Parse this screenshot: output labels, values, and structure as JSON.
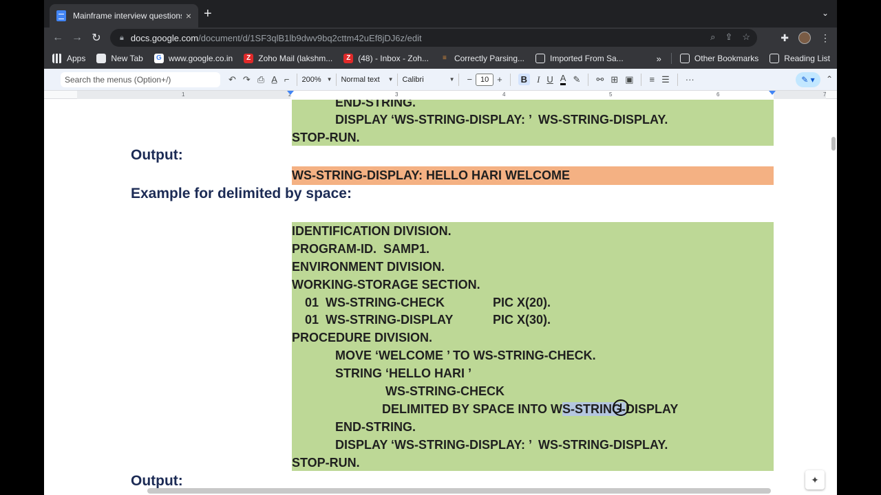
{
  "browser": {
    "tab_title": "Mainframe interview questions",
    "tab_close": "×",
    "new_tab": "+",
    "tab_menu": "⌄",
    "url_host": "docs.google.com",
    "url_path": "/document/d/1SF3qlB1lb9dwv9bq2cttm42uEf8jDJ6z/edit"
  },
  "bookmarks": [
    {
      "label": "Apps"
    },
    {
      "label": "New Tab"
    },
    {
      "label": "www.google.co.in"
    },
    {
      "label": "Zoho Mail (lakshm..."
    },
    {
      "label": "(48) - Inbox - Zoh..."
    },
    {
      "label": "Correctly Parsing..."
    },
    {
      "label": "Imported From Sa..."
    }
  ],
  "bookmarks_right": {
    "more": "»",
    "other": "Other Bookmarks",
    "reading": "Reading List"
  },
  "docs_toolbar": {
    "search_placeholder": "Search the menus (Option+/)",
    "zoom": "200%",
    "style": "Normal text",
    "font": "Calibri",
    "font_size": "10",
    "minus": "−",
    "plus": "+",
    "bold": "B",
    "italic": "I",
    "underline": "U",
    "text_color": "A",
    "more": "···"
  },
  "ruler": {
    "numbers": [
      "1",
      "2",
      "3",
      "4",
      "5",
      "6",
      "7"
    ]
  },
  "document": {
    "top_block": [
      "END-STRING.",
      "DISPLAY ‘WS-STRING-DISPLAY: ’  WS-STRING-DISPLAY.",
      "STOP-RUN."
    ],
    "output_heading_1": "Output:",
    "output_text": "WS-STRING-DISPLAY: HELLO HARI WELCOME",
    "example_heading": "Example for delimited by space:",
    "code_lines": [
      "IDENTIFICATION DIVISION.",
      "PROGRAM-ID.  SAMP1.",
      "ENVIRONMENT DIVISION.",
      "WORKING-STORAGE SECTION.",
      "01  WS-STRING-CHECK",
      "PIC X(20).",
      "01  WS-STRING-DISPLAY",
      "PIC X(30).",
      "PROCEDURE DIVISION.",
      "MOVE ‘WELCOME ’ TO WS-STRING-CHECK.",
      "STRING ‘HELLO HARI ’",
      "WS-STRING-CHECK",
      "DELIMITED BY SPACE INTO W",
      "S-STRING-",
      "DISPLAY",
      "END-STRING.",
      "DISPLAY ‘WS-STRING-DISPLAY: ’  WS-STRING-DISPLAY.",
      "STOP-RUN."
    ],
    "output_heading_2": "Output:"
  }
}
